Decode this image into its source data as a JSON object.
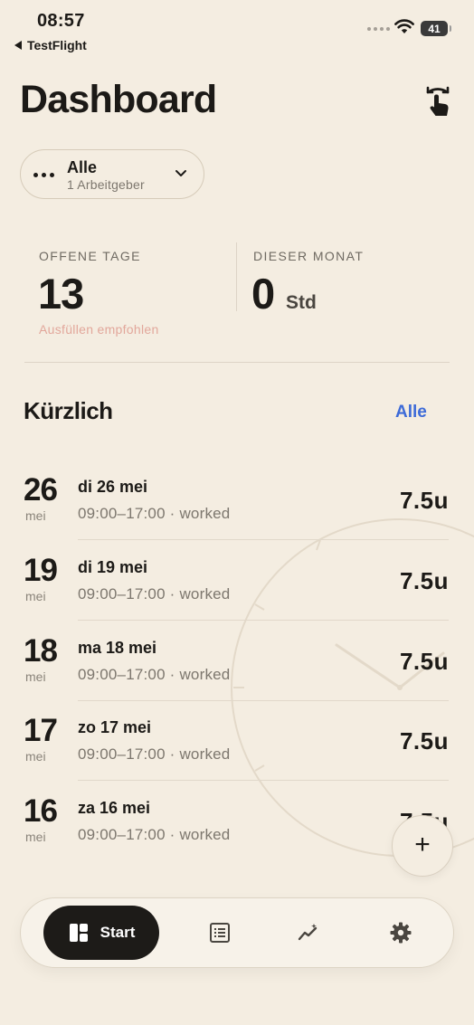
{
  "status_bar": {
    "time": "08:57",
    "back_app": "TestFlight",
    "battery": "41"
  },
  "header": {
    "title": "Dashboard",
    "action_icon": "tap-gesture-icon"
  },
  "employer_filter": {
    "title": "Alle",
    "subtitle": "1 Arbeitgeber",
    "icon": "more-dots-icon",
    "chevron": "chevron-down-icon"
  },
  "stats": {
    "open_days": {
      "label": "OFFENE TAGE",
      "value": "13",
      "hint": "Ausfüllen empfohlen"
    },
    "this_month": {
      "label": "DIESER MONAT",
      "value": "0",
      "unit": "Std"
    }
  },
  "recent": {
    "title": "Kürzlich",
    "see_all": "Alle",
    "entries": [
      {
        "day": "26",
        "month": "mei",
        "title": "di 26 mei",
        "detail": "09:00–17:00 · worked",
        "hours": "7.5u"
      },
      {
        "day": "19",
        "month": "mei",
        "title": "di 19 mei",
        "detail": "09:00–17:00 · worked",
        "hours": "7.5u"
      },
      {
        "day": "18",
        "month": "mei",
        "title": "ma 18 mei",
        "detail": "09:00–17:00 · worked",
        "hours": "7.5u"
      },
      {
        "day": "17",
        "month": "mei",
        "title": "zo 17 mei",
        "detail": "09:00–17:00 · worked",
        "hours": "7.5u"
      },
      {
        "day": "16",
        "month": "mei",
        "title": "za 16 mei",
        "detail": "09:00–17:00 · worked",
        "hours": "7.5u"
      }
    ]
  },
  "fab": {
    "label": "+",
    "icon": "plus-icon"
  },
  "tab_bar": {
    "start_label": "Start",
    "tabs": [
      "dashboard-icon",
      "list-icon",
      "trends-icon",
      "settings-gear-icon"
    ]
  },
  "colors": {
    "background": "#f4ede1",
    "accent_link": "#3d6bd8",
    "hint": "#e2a79b",
    "active_tab": "#1d1b18"
  }
}
